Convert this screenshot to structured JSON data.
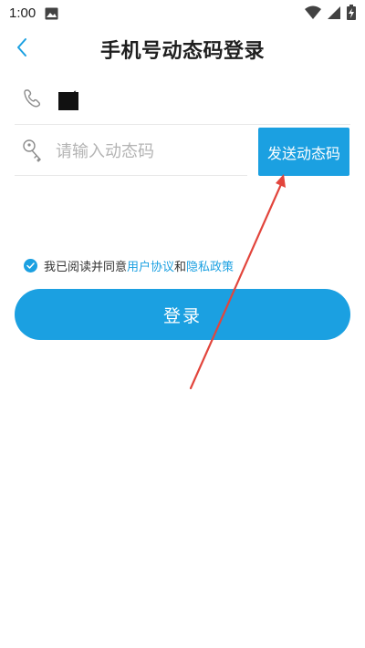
{
  "status_bar": {
    "time": "1:00",
    "icons": [
      "image-icon",
      "wifi-icon",
      "cell-signal-icon",
      "battery-charging-icon"
    ]
  },
  "header": {
    "title": "手机号动态码登录",
    "back_icon": "chevron-left-icon"
  },
  "phone": {
    "icon": "phone-icon",
    "value": "´"
  },
  "code": {
    "icon": "key-icon",
    "placeholder": "请输入动态码",
    "value": ""
  },
  "send_button": {
    "label": "发送动态码"
  },
  "agreement": {
    "checked": true,
    "prefix": "我已阅读并同意",
    "user_agreement": "用户协议",
    "and": "和",
    "privacy_policy": "隐私政策"
  },
  "login_button": {
    "label": "登录"
  },
  "colors": {
    "accent": "#1ba0e1",
    "annotation_arrow": "#e2453c"
  }
}
